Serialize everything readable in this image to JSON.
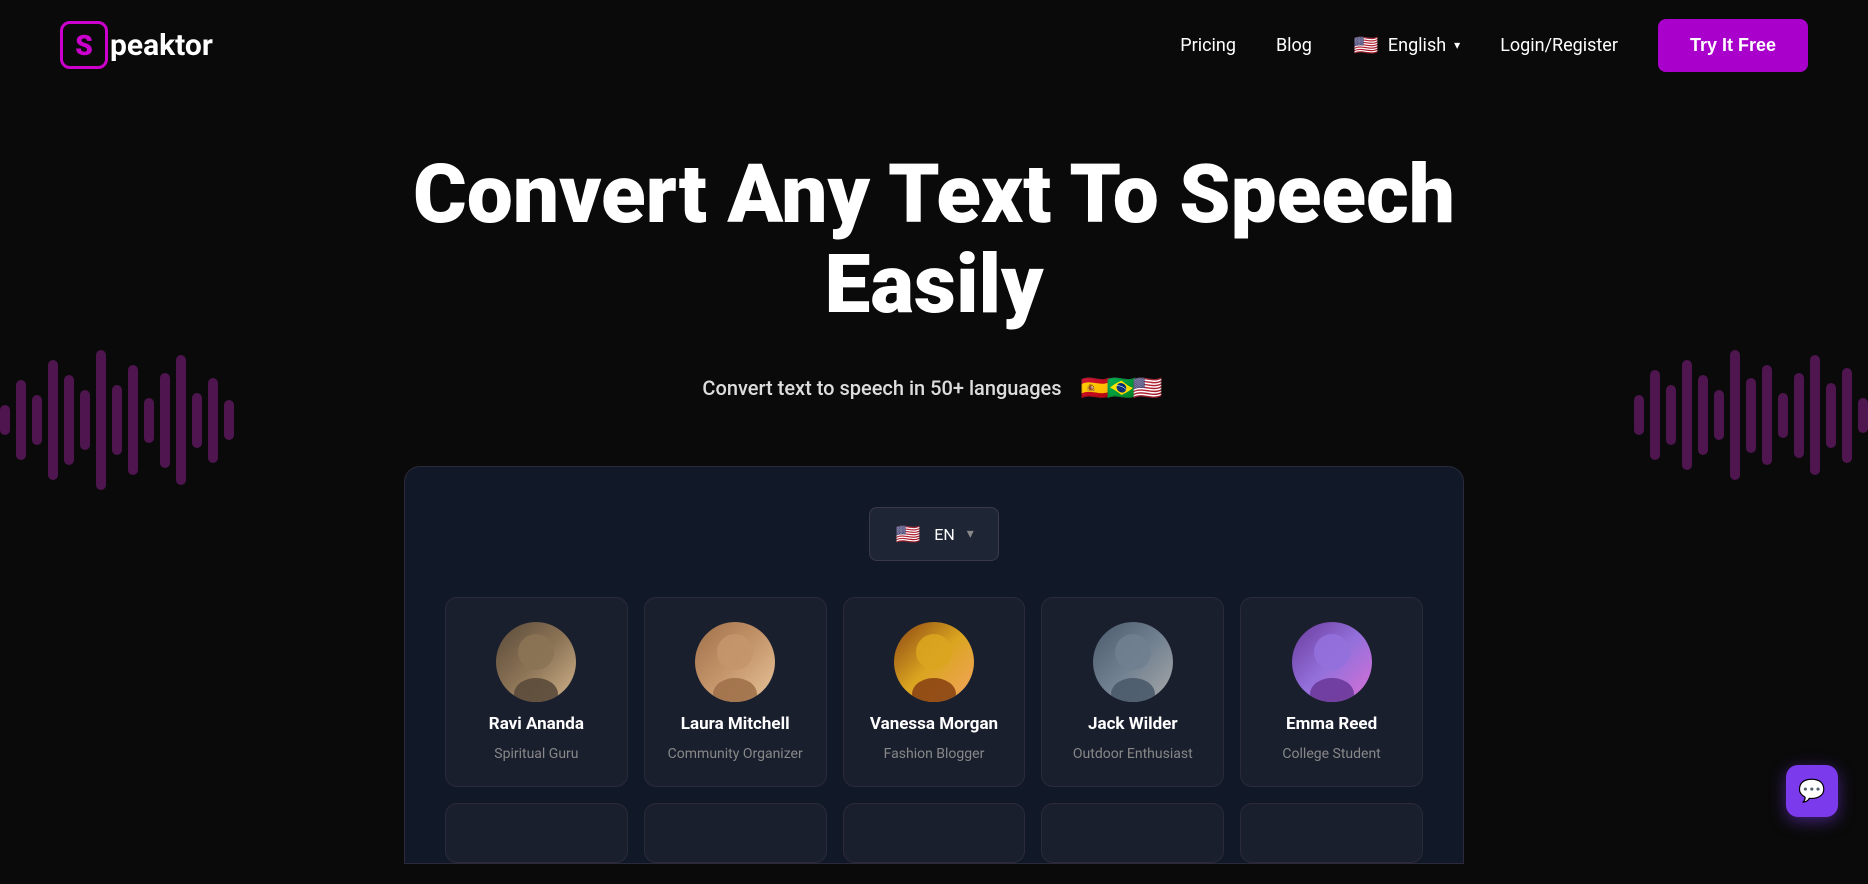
{
  "brand": {
    "logo_letter": "S",
    "logo_name": "peaktor"
  },
  "navbar": {
    "pricing_label": "Pricing",
    "blog_label": "Blog",
    "language_label": "English",
    "login_label": "Login/Register",
    "try_free_label": "Try It Free"
  },
  "hero": {
    "title": "Convert Any Text To Speech Easily",
    "subtitle": "Convert text to speech in 50+ languages",
    "flags": [
      "🇪🇸",
      "🇧🇷",
      "🇺🇸"
    ]
  },
  "app": {
    "lang_selector": {
      "flag": "🇺🇸",
      "code": "EN"
    },
    "voices": [
      {
        "name": "Ravi Ananda",
        "role": "Spiritual Guru",
        "avatar_type": "ravi"
      },
      {
        "name": "Laura Mitchell",
        "role": "Community Organizer",
        "avatar_type": "laura"
      },
      {
        "name": "Vanessa Morgan",
        "role": "Fashion Blogger",
        "avatar_type": "vanessa"
      },
      {
        "name": "Jack Wilder",
        "role": "Outdoor Enthusiast",
        "avatar_type": "jack"
      },
      {
        "name": "Emma Reed",
        "role": "College Student",
        "avatar_type": "emma"
      }
    ]
  },
  "waveform": {
    "left_bars": [
      30,
      80,
      50,
      120,
      90,
      60,
      140,
      70,
      110,
      45,
      95,
      130,
      55,
      85,
      40
    ],
    "right_bars": [
      40,
      90,
      60,
      110,
      80,
      50,
      130,
      75,
      100,
      45,
      85,
      120,
      65,
      95,
      35
    ]
  },
  "chat_widget": {
    "icon": "💬"
  }
}
